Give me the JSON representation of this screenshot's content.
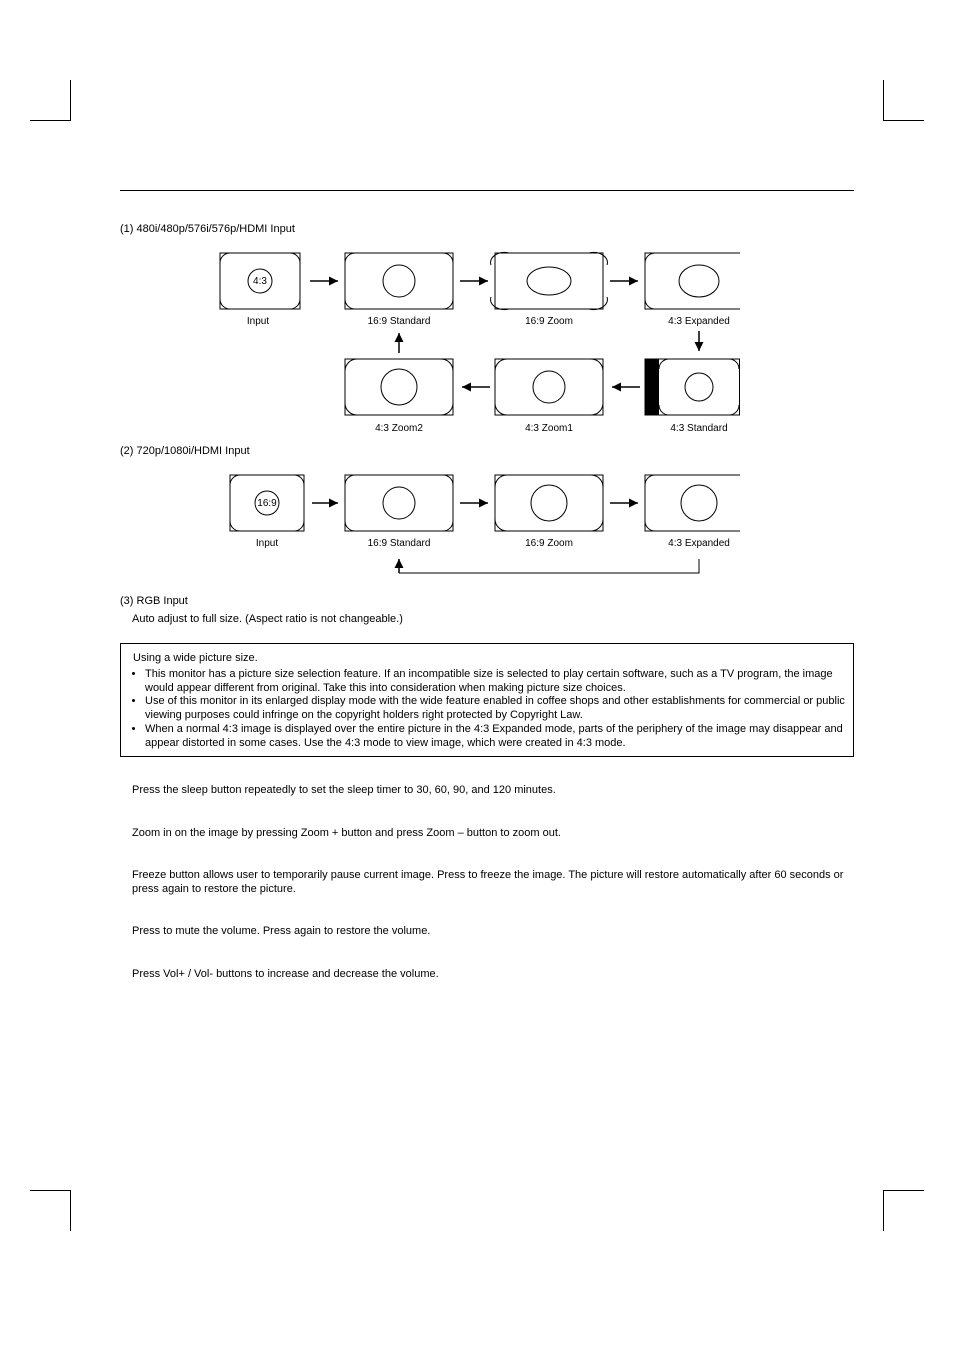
{
  "section1": {
    "heading": "(1) 480i/480p/576i/576p/HDMI Input",
    "diagram": {
      "input_ratio": "4:3",
      "labels": {
        "input": "Input",
        "std169": "16:9 Standard",
        "zoom169": "16:9 Zoom",
        "exp43": "4:3 Expanded",
        "zoom2_43": "4:3 Zoom2",
        "zoom1_43": "4:3 Zoom1",
        "std43": "4:3 Standard"
      }
    }
  },
  "section2": {
    "heading": "(2) 720p/1080i/HDMI Input",
    "diagram": {
      "input_ratio": "16:9",
      "labels": {
        "input": "Input",
        "std169": "16:9 Standard",
        "zoom169": "16:9 Zoom",
        "exp43": "4:3 Expanded"
      }
    }
  },
  "section3": {
    "heading": "(3) RGB Input",
    "body": "Auto adjust to full size. (Aspect ratio is not changeable.)"
  },
  "note": {
    "title": "Using a wide picture size.",
    "bullets": [
      "This monitor has a picture size selection feature. If an incompatible size is selected to play certain software, such as a TV program, the image would appear different from original. Take this into consideration when making picture size choices.",
      "Use of this monitor in its enlarged display mode with the wide feature enabled in coffee shops and other establishments for commercial or public viewing purposes could infringe on the copyright holders right protected by Copyright Law.",
      "When a normal 4:3 image is displayed over the entire picture in the 4:3 Expanded mode, parts of the periphery of the image may disappear and appear distorted in some cases. Use the 4:3 mode to view image, which were created in 4:3 mode."
    ]
  },
  "paras": [
    "Press the sleep button repeatedly to set the sleep timer to 30, 60, 90, and 120 minutes.",
    "Zoom in on the image by pressing Zoom + button and press Zoom – button to zoom out.",
    "Freeze button allows user to temporarily pause current image. Press to freeze the image. The picture will restore automatically after 60 seconds or press again to restore the picture.",
    "Press to mute the volume. Press again to restore the volume.",
    "Press Vol+ / Vol- buttons to increase and decrease the volume."
  ]
}
